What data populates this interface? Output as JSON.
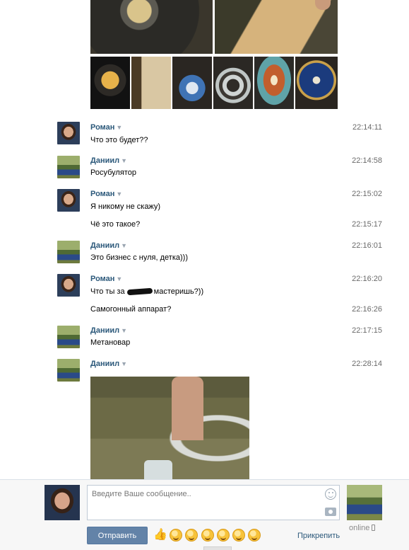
{
  "messages": [
    {
      "author": "Роман",
      "time": "22:14:11",
      "text": "Что это будет??"
    },
    {
      "author": "Даниил",
      "time": "22:14:58",
      "text": "Росубулятор"
    },
    {
      "author": "Роман",
      "time": "22:15:02",
      "text": "Я никому не скажу)"
    },
    {
      "author": "",
      "time": "22:15:17",
      "text": "Чё это такое?"
    },
    {
      "author": "Даниил",
      "time": "22:16:01",
      "text": "Это бизнес с нуля, детка)))"
    },
    {
      "author": "Роман",
      "time": "22:16:20",
      "text_before": "Что ты за ",
      "text_after": "мастеришь?))"
    },
    {
      "author": "",
      "time": "22:16:26",
      "text": "Самогонный аппарат?"
    },
    {
      "author": "Даниил",
      "time": "22:17:15",
      "text": "Метановар"
    },
    {
      "author": "Даниил",
      "time": "22:28:14",
      "text": ""
    }
  ],
  "composer": {
    "placeholder": "Введите Ваше сообщение..",
    "send_label": "Отправить",
    "attach_label": "Прикрепить",
    "peer_status": "online"
  },
  "icons": {
    "caret": "▼",
    "thumbs_up": "👍"
  }
}
